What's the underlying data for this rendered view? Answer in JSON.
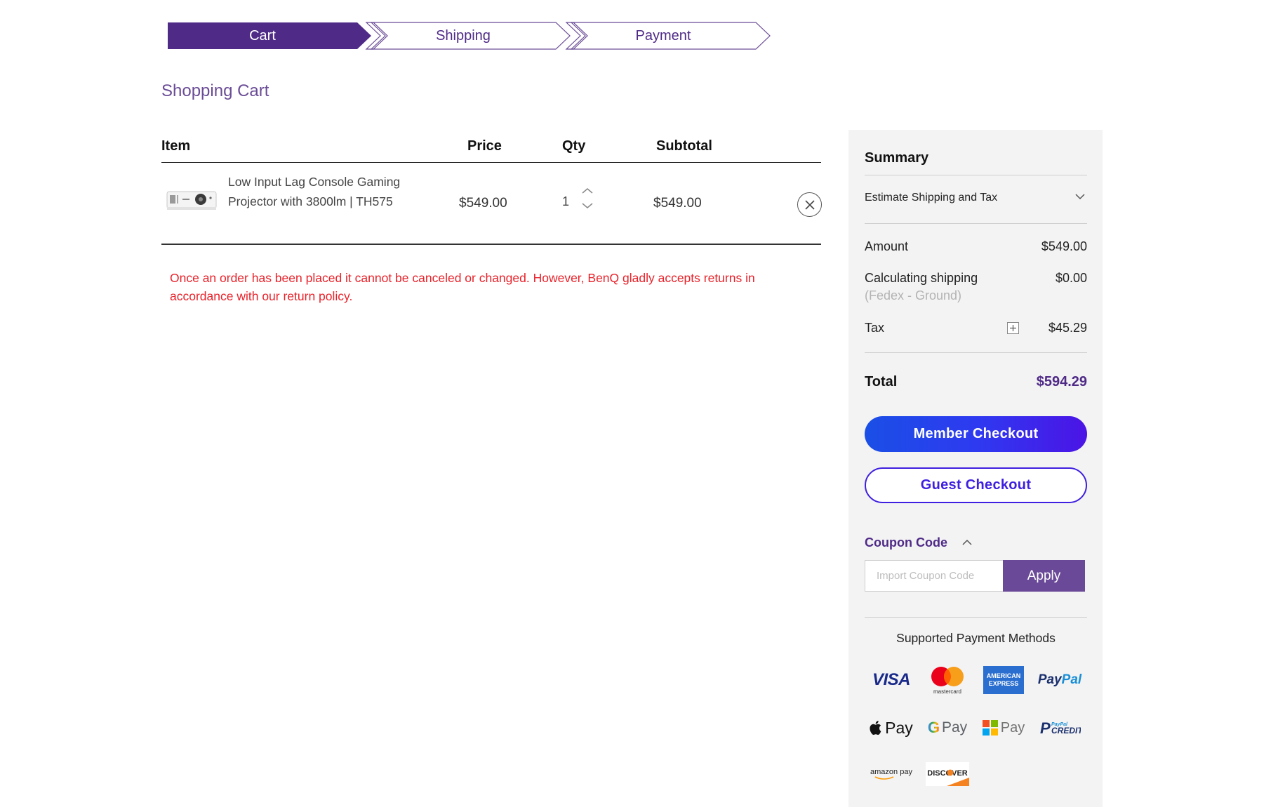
{
  "stepper": {
    "steps": [
      {
        "label": "Cart",
        "state": "active"
      },
      {
        "label": "Shipping",
        "state": "inactive"
      },
      {
        "label": "Payment",
        "state": "inactive"
      }
    ],
    "active_color": "#4f2a87"
  },
  "page": {
    "title": "Shopping Cart"
  },
  "cart": {
    "headers": {
      "item": "Item",
      "price": "Price",
      "qty": "Qty",
      "subtotal": "Subtotal"
    },
    "items": [
      {
        "name": "Low Input Lag Console Gaming Projector with 3800lm | TH575",
        "price": "$549.00",
        "qty": "1",
        "subtotal": "$549.00"
      }
    ],
    "policy_note": "Once an order has been placed it cannot be canceled or changed. However, BenQ gladly accepts returns in accordance with our return policy."
  },
  "summary": {
    "title": "Summary",
    "estimate_label": "Estimate Shipping and Tax",
    "amount_label": "Amount",
    "amount_value": "$549.00",
    "shipping_label": "Calculating shipping",
    "shipping_method": "(Fedex - Ground)",
    "shipping_value": "$0.00",
    "tax_label": "Tax",
    "tax_value": "$45.29",
    "total_label": "Total",
    "total_value": "$594.29",
    "member_checkout": "Member Checkout",
    "guest_checkout": "Guest Checkout",
    "coupon": {
      "title": "Coupon Code",
      "placeholder": "Import Coupon Code",
      "apply": "Apply"
    },
    "payment_methods_title": "Supported Payment Methods",
    "payment_methods": [
      {
        "icon": "visa-icon",
        "text": "VISA"
      },
      {
        "icon": "mastercard-icon",
        "text": "mastercard"
      },
      {
        "icon": "american-express-icon",
        "text": "AMERICAN EXPRESS"
      },
      {
        "icon": "paypal-icon",
        "text": "PayPal"
      },
      {
        "icon": "apple-pay-icon",
        "text": "Pay"
      },
      {
        "icon": "google-pay-icon",
        "text": "Pay"
      },
      {
        "icon": "microsoft-pay-icon",
        "text": "Pay"
      },
      {
        "icon": "paypal-credit-icon",
        "text": "PayPal CREDIT"
      },
      {
        "icon": "amazon-pay-icon",
        "text": "amazon pay"
      },
      {
        "icon": "discover-icon",
        "text": "DISCOVER"
      }
    ]
  }
}
